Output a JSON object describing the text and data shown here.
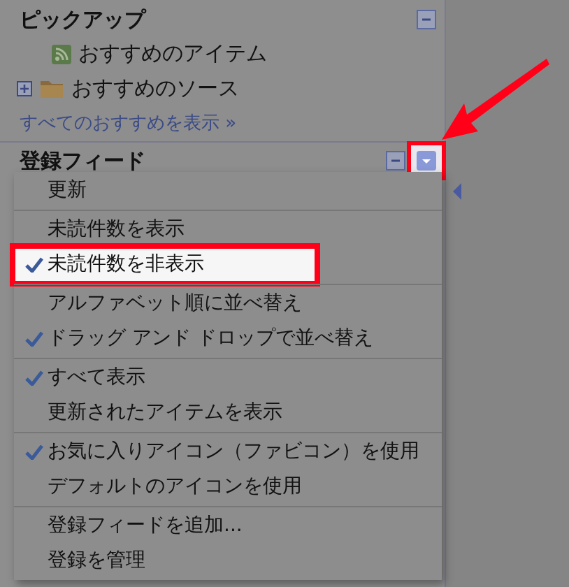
{
  "pickup": {
    "title": "ピックアップ",
    "expanded": true,
    "items": [
      {
        "kind": "feed",
        "label": "おすすめのアイテム",
        "expandable": false
      },
      {
        "kind": "folder",
        "label": "おすすめのソース",
        "expandable": true
      }
    ],
    "link": "すべてのおすすめを表示 »"
  },
  "feeds": {
    "title": "登録フィード",
    "expanded": true,
    "dropdown_annotated": true
  },
  "menu": [
    [
      {
        "label": "更新",
        "checked": false,
        "annotated": false
      }
    ],
    [
      {
        "label": "未読件数を表示",
        "checked": false,
        "annotated": false
      },
      {
        "label": "未読件数を非表示",
        "checked": true,
        "annotated": true
      }
    ],
    [
      {
        "label": "アルファベット順に並べ替え",
        "checked": false,
        "annotated": false
      },
      {
        "label": "ドラッグ アンド ドロップで並べ替え",
        "checked": true,
        "annotated": false
      }
    ],
    [
      {
        "label": "すべて表示",
        "checked": true,
        "annotated": false
      },
      {
        "label": "更新されたアイテムを表示",
        "checked": false,
        "annotated": false
      }
    ],
    [
      {
        "label": "お気に入りアイコン（ファビコン）を使用",
        "checked": true,
        "annotated": false
      },
      {
        "label": "デフォルトのアイコンを使用",
        "checked": false,
        "annotated": false
      }
    ],
    [
      {
        "label": "登録フィードを追加...",
        "checked": false,
        "annotated": false
      },
      {
        "label": "登録を管理",
        "checked": false,
        "annotated": false
      }
    ]
  ]
}
